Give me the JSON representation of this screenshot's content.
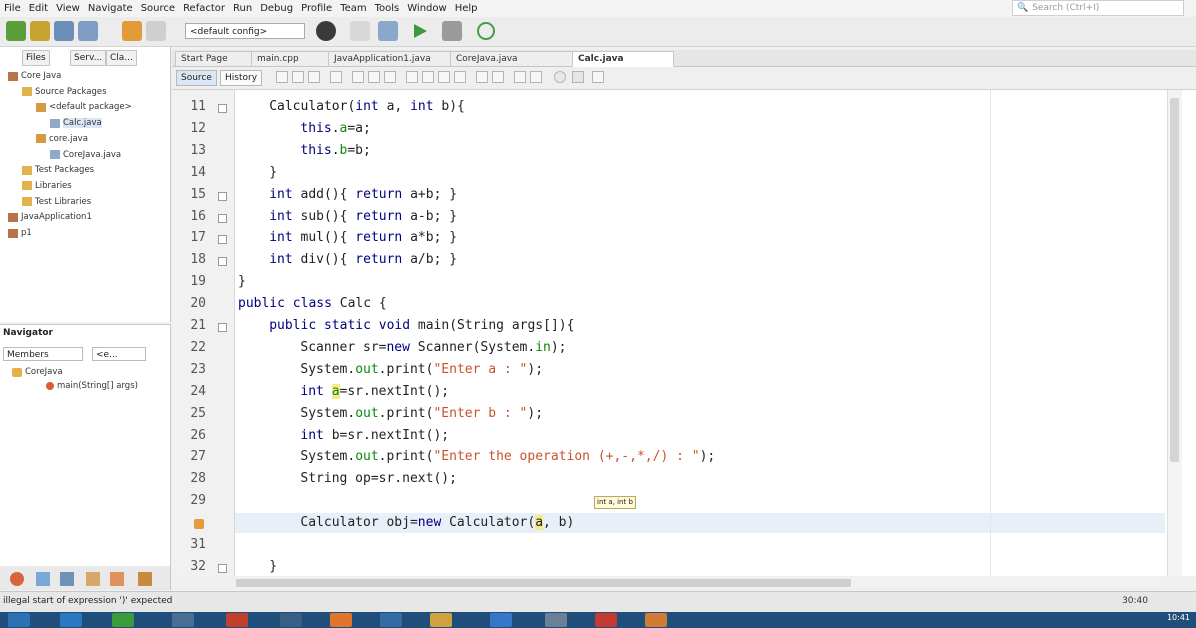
{
  "menu": [
    "File",
    "Edit",
    "View",
    "Navigate",
    "Source",
    "Refactor",
    "Run",
    "Debug",
    "Profile",
    "Team",
    "Tools",
    "Window",
    "Help"
  ],
  "search": {
    "placeholder": "Search (Ctrl+I)"
  },
  "toolbar": {
    "config": "<default config>"
  },
  "projects": {
    "tabs": [
      "Files",
      "Serv...",
      "Cla..."
    ],
    "tree": [
      {
        "label": "Core Java",
        "indent": 0,
        "icon": "coffee-cup-icon"
      },
      {
        "label": "Source Packages",
        "indent": 1,
        "icon": "folder-icon"
      },
      {
        "label": "<default package>",
        "indent": 2,
        "icon": "package-icon"
      },
      {
        "label": "Calc.java",
        "indent": 3,
        "icon": "java-file-icon"
      },
      {
        "label": "core.java",
        "indent": 2,
        "icon": "package-icon"
      },
      {
        "label": "CoreJava.java",
        "indent": 3,
        "icon": "java-file-icon"
      },
      {
        "label": "Test Packages",
        "indent": 1,
        "icon": "folder-icon"
      },
      {
        "label": "Libraries",
        "indent": 1,
        "icon": "folder-icon"
      },
      {
        "label": "Test Libraries",
        "indent": 1,
        "icon": "folder-icon"
      },
      {
        "label": "JavaApplication1",
        "indent": 0,
        "icon": "coffee-cup-icon"
      },
      {
        "label": "p1",
        "indent": 0,
        "icon": "coffee-cup-icon"
      }
    ]
  },
  "navigator": {
    "title": "Navigator",
    "members": "Members",
    "filter": "<e...",
    "tree": [
      {
        "label": "CoreJava",
        "indent": 0
      },
      {
        "label": "main(String[] args)",
        "indent": 1
      }
    ]
  },
  "editor": {
    "tabs": [
      "Start Page",
      "main.cpp",
      "JavaApplication1.java",
      "CoreJava.java",
      "Calc.java"
    ],
    "active_tab": "Calc.java",
    "source_label": "Source",
    "history_label": "History",
    "hint": "int a, int b",
    "lines": [
      {
        "n": "11",
        "fold": true
      },
      {
        "n": "12",
        "fold": false
      },
      {
        "n": "13",
        "fold": false
      },
      {
        "n": "14",
        "fold": false
      },
      {
        "n": "15",
        "fold": true
      },
      {
        "n": "16",
        "fold": true
      },
      {
        "n": "17",
        "fold": true
      },
      {
        "n": "18",
        "fold": true
      },
      {
        "n": "19",
        "fold": false
      },
      {
        "n": "20",
        "fold": false
      },
      {
        "n": "21",
        "fold": true
      },
      {
        "n": "22",
        "fold": false
      },
      {
        "n": "23",
        "fold": false
      },
      {
        "n": "24",
        "fold": false
      },
      {
        "n": "25",
        "fold": false
      },
      {
        "n": "26",
        "fold": false
      },
      {
        "n": "27",
        "fold": false
      },
      {
        "n": "28",
        "fold": false
      },
      {
        "n": "29",
        "fold": false
      },
      {
        "n": "",
        "fold": false
      },
      {
        "n": "31",
        "fold": false
      },
      {
        "n": "32",
        "fold": true
      }
    ],
    "code": {
      "l11": [
        "Calculator(",
        "int",
        " a, ",
        "int",
        " b){"
      ],
      "l12": [
        "this",
        ".",
        "a",
        "=a;"
      ],
      "l13": [
        "this",
        ".",
        "b",
        "=b;"
      ],
      "l14": [
        "}"
      ],
      "l15": [
        "int",
        " add(){ ",
        "return",
        " a+b; }"
      ],
      "l16": [
        "int",
        " sub(){ ",
        "return",
        " a-b; }"
      ],
      "l17": [
        "int",
        " mul(){ ",
        "return",
        " a*b; }"
      ],
      "l18": [
        "int",
        " div(){ ",
        "return",
        " a/b; }"
      ],
      "l19": [
        "}"
      ],
      "l20": [
        "public class",
        " Calc {"
      ],
      "l21": [
        "public static void",
        " main(String args[]){"
      ],
      "l22": [
        "Scanner sr=",
        "new",
        " Scanner(System.",
        "in",
        ");"
      ],
      "l23": [
        "System.",
        "out",
        ".print(",
        "\"Enter a : \"",
        ");"
      ],
      "l24": [
        "int",
        " ",
        "a",
        "=sr.nextInt();"
      ],
      "l25": [
        "System.",
        "out",
        ".print(",
        "\"Enter b : \"",
        ");"
      ],
      "l26": [
        "int",
        " b=sr.nextInt();"
      ],
      "l27": [
        "System.",
        "out",
        ".print(",
        "\"Enter the operation (+,-,*,/) : \"",
        ");"
      ],
      "l28": [
        "String op=sr.next();"
      ],
      "l30": [
        "Calculator obj=",
        "new",
        " Calculator(",
        "a",
        ", b)"
      ],
      "l32": [
        "}"
      ]
    }
  },
  "status": {
    "message": "illegal start of expression ')' expected",
    "position": "30:40"
  },
  "taskbar": {
    "clock": "10:41"
  }
}
